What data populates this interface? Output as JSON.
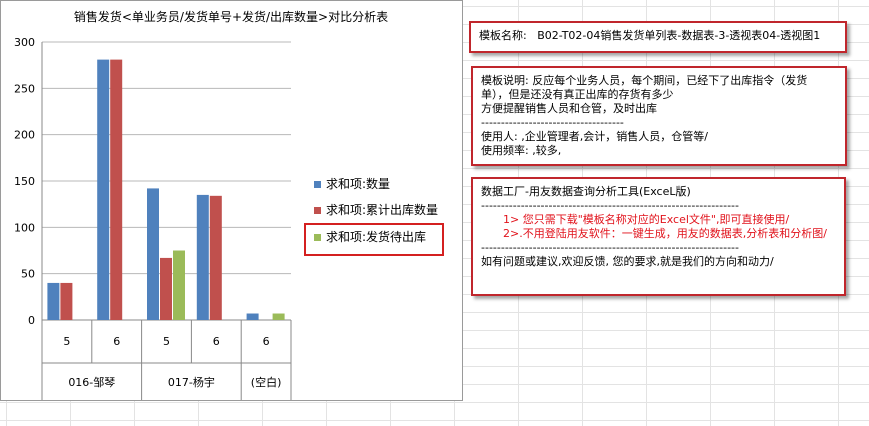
{
  "chart_data": {
    "type": "bar",
    "title": "销售发货<单业务员/发货单号+发货/出库数量>对比分析表",
    "xlabel": "",
    "ylabel": "",
    "ylim": [
      0,
      300
    ],
    "yticks": [
      "0",
      "50",
      "100",
      "150",
      "200",
      "250",
      "300"
    ],
    "grid": true,
    "legend_position": "right",
    "groups": [
      {
        "label": "016-邹琴",
        "categories": [
          "5",
          "6"
        ]
      },
      {
        "label": "017-杨宇",
        "categories": [
          "5",
          "6"
        ]
      },
      {
        "label": "(空白)",
        "categories": [
          "6"
        ]
      }
    ],
    "series": [
      {
        "name": "求和项:数量",
        "color": "#4f81bd",
        "values": [
          40,
          281,
          142,
          135,
          7
        ]
      },
      {
        "name": "求和项:累计出库数量",
        "color": "#c0504d",
        "values": [
          40,
          281,
          67,
          134,
          0
        ]
      },
      {
        "name": "求和项:发货待出库",
        "color": "#9bbb59",
        "values": [
          0,
          0,
          75,
          0,
          7
        ]
      }
    ]
  },
  "info": {
    "template_name": "模板名称:   B02-T02-04销售发货单列表-数据表-3-透视表04-透视图1",
    "desc_lines": [
      "模板说明: 反应每个业务人员，每个期间，已经下了出库指令（发货",
      "单），但是还没有真正出库的存货有多少",
      "方便提醒销售人员和仓管，及时出库",
      "------------------------------------",
      "使用人: ,企业管理者,会计，销售人员，仓管等/",
      "使用频率: ,较多,"
    ],
    "tool_lines": [
      "数据工厂-用友数据查询分析工具(ExceL版)",
      "-----------------------------------------------------------------",
      "1> 您只需下载\"模板名称对应的Excel文件\",即可直接使用/",
      "2>.不用登陆用友软件：一键生成，用友的数据表,分析表和分析图/",
      "-----------------------------------------------------------------",
      "如有问题或建议,欢迎反馈, 您的要求,就是我们的方向和动力/"
    ]
  }
}
